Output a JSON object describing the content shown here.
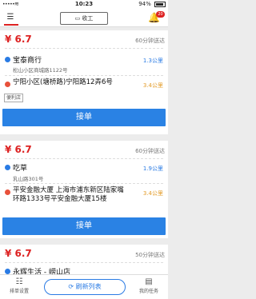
{
  "status_bar": {
    "time": "10:23",
    "battery": "94%"
  },
  "header": {
    "receive_button": "收工",
    "badge_count": "20"
  },
  "orders": [
    {
      "price": "¥ 6.7",
      "eta": "60分钟送达",
      "pickup": {
        "name": "宝泰商行",
        "address": "松山小区商城路1122号",
        "distance": "1.3公里"
      },
      "dropoff": {
        "address": "宁阳小区(塘桥路)宁阳路12弄6号",
        "distance": "3.4公里"
      },
      "tag": "便利店",
      "accept_label": "接单"
    },
    {
      "price": "¥ 6.7",
      "eta": "60分钟送达",
      "pickup": {
        "name": "吃草",
        "address": "乳山路301号",
        "distance": "1.9公里"
      },
      "dropoff": {
        "address": "平安金融大厦 上海市浦东新区陆家嘴环路1333号平安金融大厦15楼",
        "distance": "3.4公里"
      },
      "accept_label": "接单"
    },
    {
      "price": "¥ 6.7",
      "eta": "50分钟送达",
      "pickup": {
        "name": "永辉生活 - 崂山店"
      }
    }
  ],
  "tabbar": {
    "left": "排单设置",
    "refresh": "刷新列表",
    "right": "我的任务"
  },
  "colors": {
    "accent": "#2a82e4",
    "price": "#dd2222",
    "pickup_dot": "#2a7be4",
    "dropoff_dot": "#e8513b"
  }
}
